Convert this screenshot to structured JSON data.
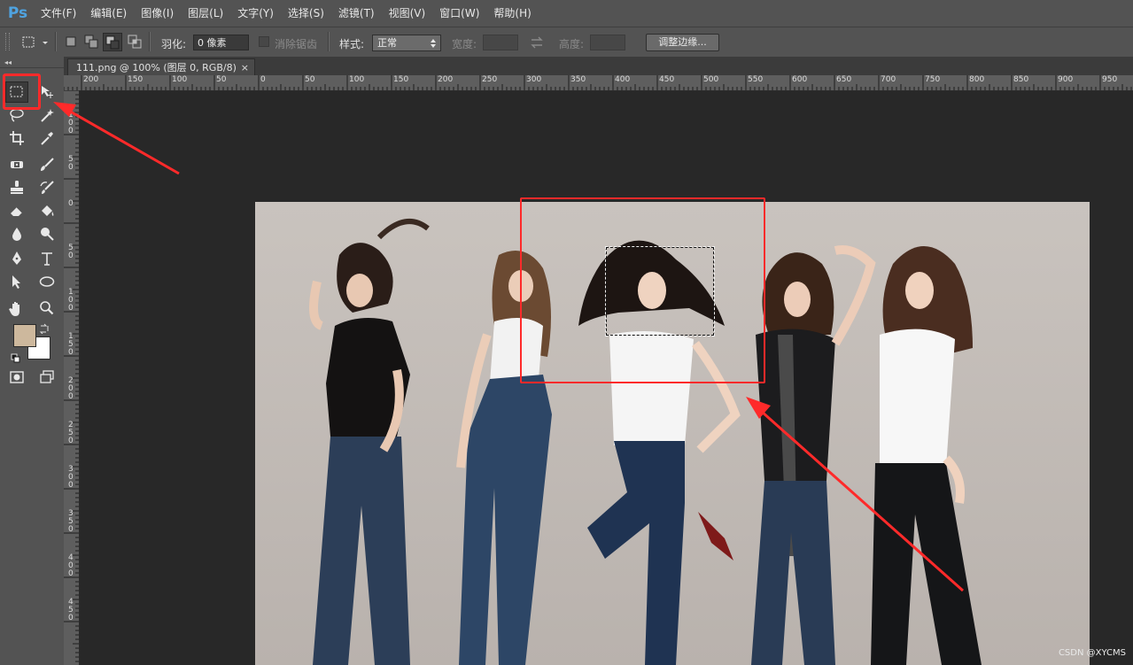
{
  "app": {
    "logo": "Ps"
  },
  "menu": [
    "文件(F)",
    "编辑(E)",
    "图像(I)",
    "图层(L)",
    "文字(Y)",
    "选择(S)",
    "滤镜(T)",
    "视图(V)",
    "窗口(W)",
    "帮助(H)"
  ],
  "options": {
    "feather_label": "羽化:",
    "feather_value": "0 像素",
    "antialias_label": "消除锯齿",
    "style_label": "样式:",
    "style_value": "正常",
    "width_label": "宽度:",
    "height_label": "高度:",
    "refine_button": "调整边缘..."
  },
  "document": {
    "tab_title": "111.png @ 100% (图层 0, RGB/8)",
    "close_symbol": "×",
    "watermark": "CSDN @XYCMS"
  },
  "rulers": {
    "h_labels": [
      "200",
      "150",
      "100",
      "50",
      "0",
      "50",
      "100",
      "150",
      "200",
      "250",
      "300",
      "350",
      "400",
      "450",
      "500",
      "550",
      "600",
      "650",
      "700",
      "750",
      "800",
      "850",
      "900",
      "950"
    ],
    "v_labels": [
      "1\n0\n0",
      "5\n0",
      "0",
      "5\n0",
      "1\n0\n0",
      "1\n5\n0",
      "2\n0\n0",
      "2\n5\n0",
      "3\n0\n0",
      "3\n5\n0",
      "4\n0\n0",
      "4\n5\n0"
    ]
  },
  "tools": [
    "rectangular-marquee-icon",
    "move-icon",
    "lasso-icon",
    "magic-wand-icon",
    "crop-icon",
    "eyedropper-icon",
    "spot-healing-icon",
    "brush-icon",
    "clone-stamp-icon",
    "history-brush-icon",
    "eraser-icon",
    "paint-bucket-icon",
    "blur-icon",
    "dodge-icon",
    "pen-icon",
    "type-icon",
    "path-selection-icon",
    "ellipse-icon",
    "hand-icon",
    "zoom-icon"
  ],
  "colors": {
    "foreground": "#cdb89d",
    "background": "#ffffff",
    "annotation": "#ff2a2a",
    "photo_bg": "#c6c0bb"
  }
}
